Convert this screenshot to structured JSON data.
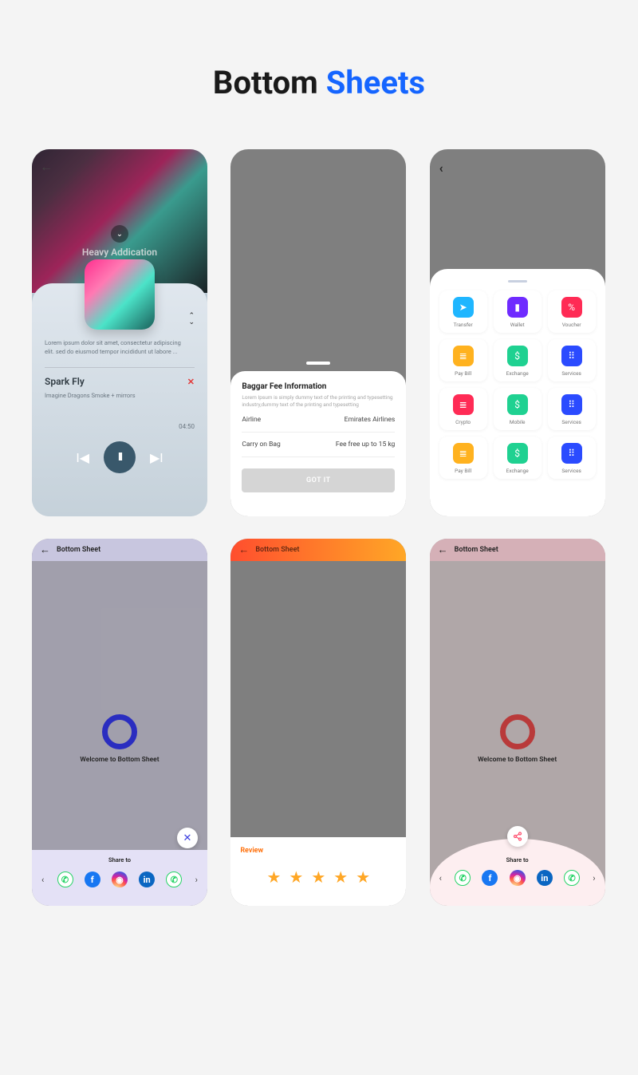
{
  "title": {
    "part1": "Bottom ",
    "part2": "Sheets"
  },
  "card1": {
    "overlay_title": "Heavy Addication",
    "description": "Lorem ipsum dolor sit amet, consectetur adipiscing elit. sed do eiusmod tempor incididunt ut labore ...",
    "track_name": "Spark Fly",
    "artist": "Imagine Dragons Smoke + mirrors",
    "time": "04:50"
  },
  "card2": {
    "title": "Baggar Fee Information",
    "subtitle": "Lorem Ipsum is simply dummy text of the printing and typesetting industry,dummy text of the printing and typesetting",
    "rows": [
      {
        "label": "Airline",
        "value": "Emirates Airlines"
      },
      {
        "label": "Carry on Bag",
        "value": "Fee free up to 15 kg"
      }
    ],
    "button": "GOT IT"
  },
  "card3": {
    "items": [
      {
        "label": "Transfer",
        "color": "#1fb6ff",
        "glyph": "➤"
      },
      {
        "label": "Wallet",
        "color": "#6f2bff",
        "glyph": "▮"
      },
      {
        "label": "Voucher",
        "color": "#ff2b55",
        "glyph": "%"
      },
      {
        "label": "Pay Bill",
        "color": "#ffb21f",
        "glyph": "≣"
      },
      {
        "label": "Exchange",
        "color": "#1fd191",
        "glyph": "$"
      },
      {
        "label": "Services",
        "color": "#2b4bff",
        "glyph": "⠿"
      },
      {
        "label": "Crypto",
        "color": "#ff2b55",
        "glyph": "≣"
      },
      {
        "label": "Mobile",
        "color": "#1fd191",
        "glyph": "$"
      },
      {
        "label": "Services",
        "color": "#2b4bff",
        "glyph": "⠿"
      },
      {
        "label": "Pay Bill",
        "color": "#ffb21f",
        "glyph": "≣"
      },
      {
        "label": "Exchange",
        "color": "#1fd191",
        "glyph": "$"
      },
      {
        "label": "Services",
        "color": "#2b4bff",
        "glyph": "⠿"
      }
    ]
  },
  "card4": {
    "header": "Bottom Sheet",
    "welcome": "Welcome to Bottom Sheet",
    "share_label": "Share to"
  },
  "card5": {
    "header": "Bottom Sheet",
    "review_label": "Review",
    "stars": 5
  },
  "card6": {
    "header": "Bottom Sheet",
    "welcome": "Welcome to Bottom Sheet",
    "share_label": "Share to"
  }
}
